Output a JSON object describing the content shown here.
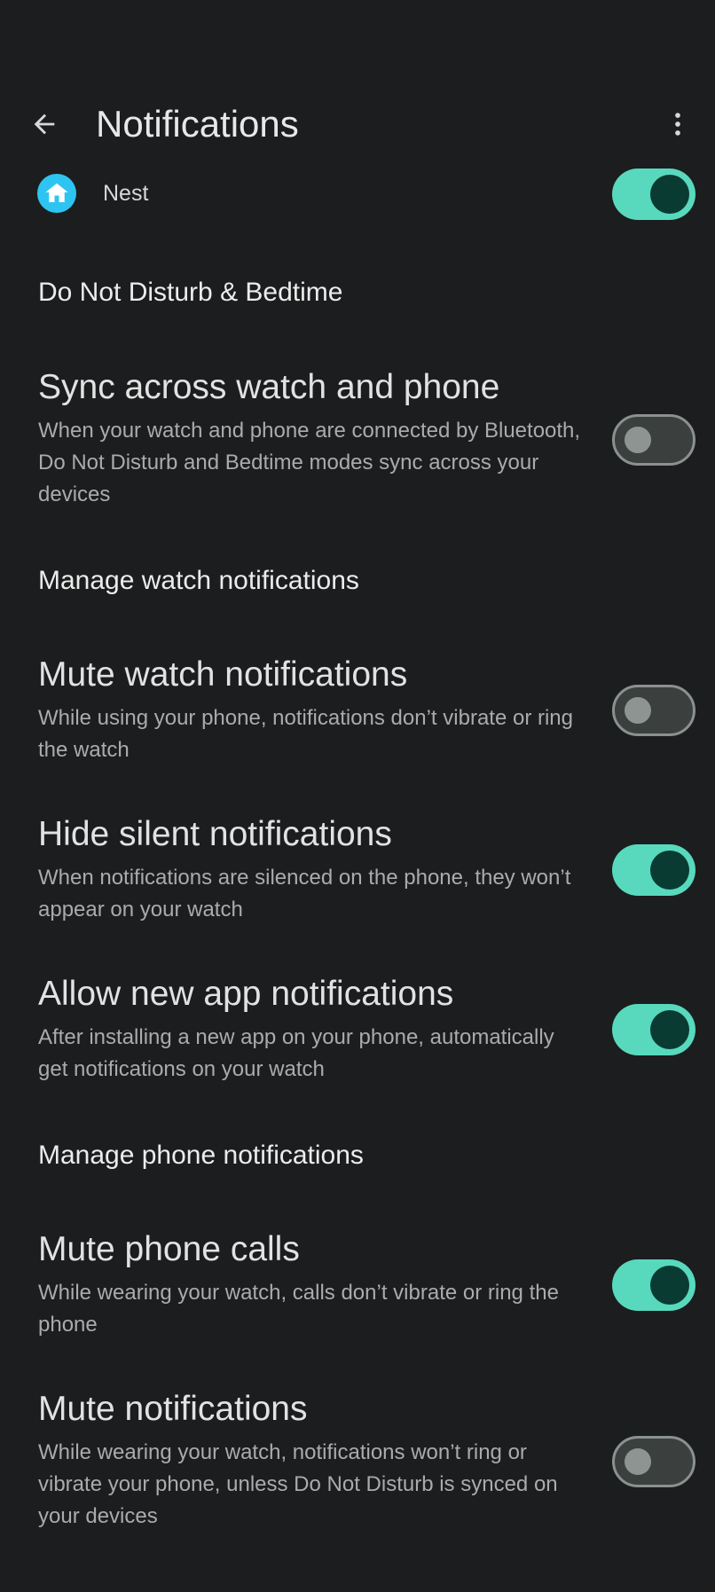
{
  "header": {
    "title": "Notifications"
  },
  "nest": {
    "label": "Nest",
    "enabled": true
  },
  "sections": {
    "dnd": "Do Not Disturb & Bedtime",
    "watch": "Manage watch notifications",
    "phone": "Manage phone notifications"
  },
  "settings": {
    "sync": {
      "title": "Sync across watch and phone",
      "description": "When your watch and phone are connected by Bluetooth, Do Not Disturb and Bedtime modes sync across your devices",
      "enabled": false
    },
    "mute_watch": {
      "title": "Mute watch notifications",
      "description": "While using your phone, notifications don’t vibrate or ring the watch",
      "enabled": false
    },
    "hide_silent": {
      "title": "Hide silent notifications",
      "description": "When notifications are silenced on the phone, they won’t appear on your watch",
      "enabled": true
    },
    "allow_new": {
      "title": "Allow new app notifications",
      "description": "After installing a new app on your phone, automatically get notifications on your watch",
      "enabled": true
    },
    "mute_calls": {
      "title": "Mute phone calls",
      "description": "While wearing your watch, calls don’t vibrate or ring the phone",
      "enabled": true
    },
    "mute_notifs": {
      "title": "Mute notifications",
      "description": "While wearing your watch, notifications won’t ring or vibrate your phone, unless Do Not Disturb is synced on your devices",
      "enabled": false
    }
  },
  "colors": {
    "background": "#1c1d1e",
    "toggle_on_track": "#58d9bd",
    "toggle_on_knob": "#0a3b32",
    "toggle_off_track": "#3b403f",
    "nest_icon": "#2ec4f2"
  }
}
